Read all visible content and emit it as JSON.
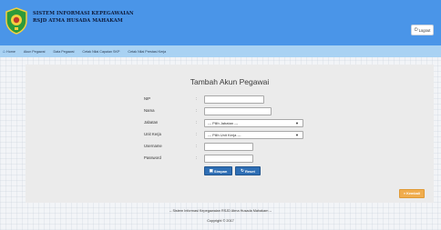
{
  "header": {
    "title_line1": "SISTEM INFORMASI KEPEGAWAIAN",
    "title_line2": "RSJD ATMA HUSADA MAHAKAM",
    "logout_label": "Logout"
  },
  "navbar": {
    "items": [
      "Home",
      "Akun Pegawai",
      "Data Pegawai",
      "Cetak Nilai Capaian SKP",
      "Cetak Nilai Prestasi Kerja"
    ]
  },
  "form": {
    "title": "Tambah Akun Pegawai",
    "fields": [
      {
        "label": "NIP",
        "type": "text",
        "value": ""
      },
      {
        "label": "Nama",
        "type": "text",
        "value": ""
      },
      {
        "label": "Jabatan",
        "type": "select",
        "value": "--- Pilih Jabatan ---"
      },
      {
        "label": "Unit Kerja",
        "type": "select",
        "value": "--- Pilih Unit Kerja ---"
      },
      {
        "label": "Username",
        "type": "text",
        "value": ""
      },
      {
        "label": "Password",
        "type": "password",
        "value": ""
      }
    ],
    "save_label": "Simpan",
    "reset_label": "Reset"
  },
  "back_label": "Kembali",
  "footer": {
    "line1": "-- Sistem Informasi Kepegawaian RSJD Atma Husada Mahakam --",
    "line2": "Copyright © 2017"
  },
  "colors": {
    "header": "#4a95e8",
    "navbar": "#a9d2f3",
    "primary_button": "#2f6fb5",
    "warning_button": "#f0ad4e"
  }
}
